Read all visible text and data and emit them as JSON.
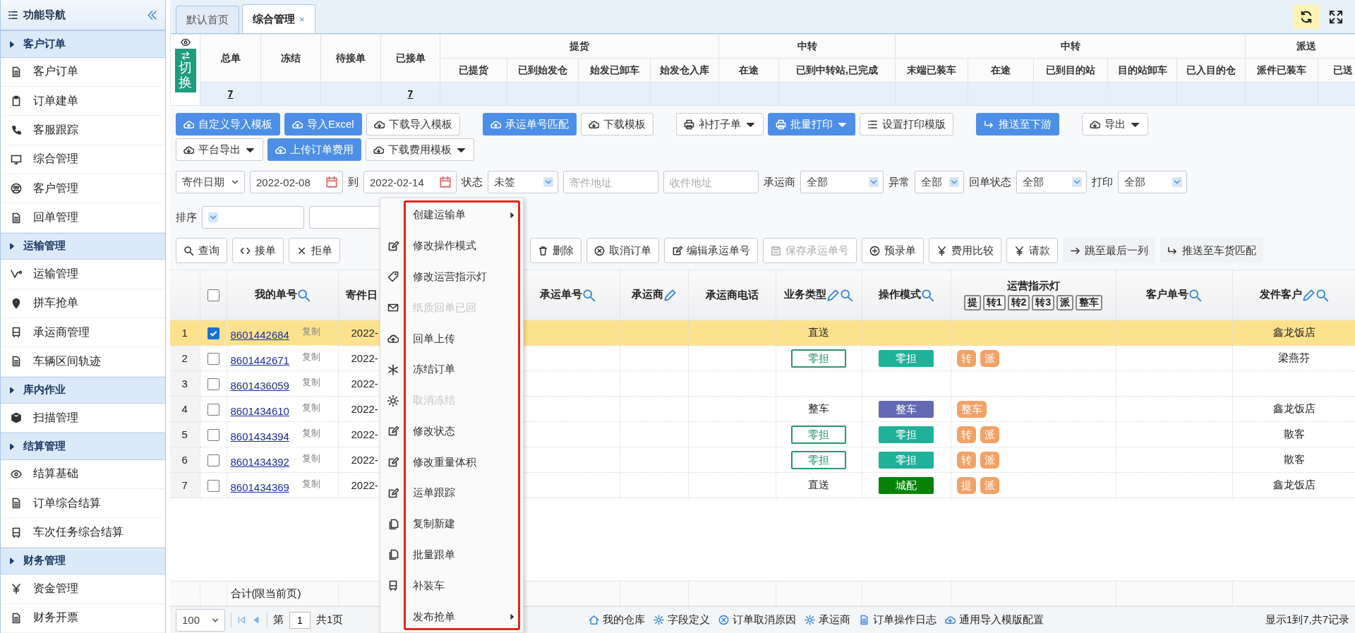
{
  "tabs": [
    {
      "label": "默认首页",
      "selected": false
    },
    {
      "label": "综合管理",
      "selected": true,
      "close": "×"
    }
  ],
  "sidebar": {
    "title": "功能导航",
    "groups": [
      {
        "label": "客户订单",
        "items": [
          "客户订单",
          "订单建单",
          "客服跟踪",
          "综合管理",
          "客户管理",
          "回单管理"
        ]
      },
      {
        "label": "运输管理",
        "items": [
          "运输管理",
          "拼车抢单",
          "承运商管理",
          "车辆区间轨迹"
        ]
      },
      {
        "label": "库内作业",
        "items": [
          "扫描管理"
        ]
      },
      {
        "label": "结算管理",
        "items": [
          "结算基础",
          "订单综合结算",
          "车次任务综合结算"
        ]
      },
      {
        "label": "财务管理",
        "items": [
          "资金管理",
          "财务开票"
        ]
      }
    ]
  },
  "summary": {
    "toggle": "切换",
    "columns": [
      {
        "label": "总单",
        "value": "7"
      },
      {
        "label": "冻结"
      },
      {
        "label": "待接单"
      },
      {
        "label": "已接单",
        "value": "7"
      }
    ],
    "groups": [
      {
        "label": "提货",
        "columns": [
          "已提货",
          "已到始发仓",
          "始发已卸车",
          "始发仓入库"
        ]
      },
      {
        "label": "中转",
        "columns": [
          "在途",
          "已到中转站,已完成"
        ]
      },
      {
        "label": "中转",
        "columns": [
          "末端已装车",
          "在途",
          "已到目的站",
          "目的站卸车",
          "已入目的仓"
        ]
      },
      {
        "label": "派送",
        "columns": [
          "派件已装车",
          "已送"
        ]
      }
    ]
  },
  "toolbar": [
    [
      {
        "label": "自定义导入模板",
        "kind": "primary",
        "dropdown": false
      },
      {
        "label": "导入Excel",
        "kind": "primary",
        "dropdown": false
      },
      {
        "label": "下载导入模板",
        "kind": "default",
        "dropdown": false
      },
      {
        "label": "承运单号匹配",
        "kind": "primary",
        "dropdown": false
      },
      {
        "label": "下载模板",
        "kind": "default",
        "dropdown": false
      },
      {
        "label": "补打子单",
        "kind": "default",
        "dropdown": true
      },
      {
        "label": "批量打印",
        "kind": "primary",
        "dropdown": true
      },
      {
        "label": "设置打印模版",
        "kind": "default",
        "dropdown": false
      },
      {
        "label": "推送至下游",
        "kind": "primary",
        "dropdown": false
      },
      {
        "label": "导出",
        "kind": "default",
        "dropdown": true
      }
    ],
    [
      {
        "label": "平台导出",
        "kind": "default",
        "dropdown": true
      },
      {
        "label": "上传订单费用",
        "kind": "primary",
        "dropdown": false
      },
      {
        "label": "下载费用模板",
        "kind": "default",
        "dropdown": true
      }
    ]
  ],
  "filters": {
    "date_field": "寄件日期",
    "date_from": "2022-02-08",
    "to": "到",
    "date_to": "2022-02-14",
    "status_label": "状态",
    "status": "未签",
    "sender_address_placeholder": "寄件地址",
    "receiver_address_placeholder": "收件地址",
    "carrier_label": "承运商",
    "carrier": "全部",
    "exception_label": "异常",
    "exception": "全部",
    "receipt_label": "回单状态",
    "receipt": "全部",
    "print_label": "打印",
    "print": "全部"
  },
  "sort": {
    "label": "排序"
  },
  "actions": [
    {
      "label": "查询",
      "disabled": false
    },
    {
      "label": "接单",
      "disabled": false
    },
    {
      "label": "拒单",
      "disabled": false
    },
    {
      "label": "删除",
      "disabled": false
    },
    {
      "label": "取消订单",
      "disabled": false
    },
    {
      "label": "编辑承运单号",
      "disabled": false
    },
    {
      "label": "保存承运单号",
      "disabled": true
    },
    {
      "label": "预录单",
      "disabled": false
    },
    {
      "label": "费用比较",
      "disabled": false
    },
    {
      "label": "请款",
      "disabled": false
    },
    {
      "label": "跳至最后一列",
      "disabled": false
    },
    {
      "label": "推送至车货匹配",
      "disabled": false
    }
  ],
  "table": {
    "header_checked": false,
    "columns": [
      {
        "kind": "rownum"
      },
      {
        "kind": "check"
      },
      {
        "kind": "text",
        "label": "我的单号",
        "search": true,
        "edit": false
      },
      {
        "kind": "text",
        "label": "寄件日",
        "search": false,
        "edit": false
      },
      {
        "kind": "blank"
      },
      {
        "kind": "text",
        "label": "承运单号",
        "search": true,
        "edit": false
      },
      {
        "kind": "text",
        "label": "承运商",
        "search": false,
        "edit": true
      },
      {
        "kind": "text",
        "label": "承运商电话",
        "search": false,
        "edit": false
      },
      {
        "kind": "text",
        "label": "业务类型",
        "search": true,
        "edit": true
      },
      {
        "kind": "text",
        "label": "操作模式",
        "search": true,
        "edit": false
      },
      {
        "kind": "lights",
        "label": "运营指示灯",
        "chips": [
          "提",
          "转1",
          "转2",
          "转3",
          "派",
          "整车"
        ]
      },
      {
        "kind": "text",
        "label": "客户单号",
        "search": true,
        "edit": false
      },
      {
        "kind": "text",
        "label": "发件客户",
        "search": true,
        "edit": true
      }
    ],
    "rows": [
      {
        "num": "1",
        "selected": true,
        "checked": true,
        "order_no": "8601442684",
        "copy": "复制",
        "date": "2022-",
        "biz_type": "直送",
        "biz_outlined": false,
        "lights": [],
        "sender": "鑫龙饭店"
      },
      {
        "num": "2",
        "selected": false,
        "checked": false,
        "order_no": "8601442671",
        "copy": "复制",
        "date": "2022-",
        "biz_type": "零担",
        "biz_outlined": true,
        "op_mode": {
          "text": "零担",
          "color": "#1fb199"
        },
        "lights": [
          "转",
          "派"
        ],
        "sender": "梁燕芬"
      },
      {
        "num": "3",
        "selected": false,
        "checked": false,
        "order_no": "8601436059",
        "copy": "复制",
        "date": "2022-",
        "lights": []
      },
      {
        "num": "4",
        "selected": false,
        "checked": false,
        "order_no": "8601434610",
        "copy": "复制",
        "date": "2022-",
        "biz_type": "整车",
        "biz_outlined": false,
        "op_mode": {
          "text": "整车",
          "color": "#6469b4"
        },
        "lights": [
          "整车"
        ],
        "sender": "鑫龙饭店"
      },
      {
        "num": "5",
        "selected": false,
        "checked": false,
        "order_no": "8601434394",
        "copy": "复制",
        "date": "2022-",
        "biz_type": "零担",
        "biz_outlined": true,
        "op_mode": {
          "text": "零担",
          "color": "#1fb199"
        },
        "lights": [
          "转",
          "派"
        ],
        "sender": "散客"
      },
      {
        "num": "6",
        "selected": false,
        "checked": false,
        "order_no": "8601434392",
        "copy": "复制",
        "date": "2022-",
        "biz_type": "零担",
        "biz_outlined": true,
        "op_mode": {
          "text": "零担",
          "color": "#1fb199"
        },
        "lights": [
          "转",
          "派"
        ],
        "sender": "散客"
      },
      {
        "num": "7",
        "selected": false,
        "checked": false,
        "order_no": "8601434369",
        "copy": "复制",
        "date": "2022-",
        "biz_type": "直送",
        "biz_outlined": false,
        "op_mode": {
          "text": "城配",
          "color": "#078207"
        },
        "lights": [
          "提",
          "派"
        ],
        "sender": "鑫龙饭店"
      }
    ],
    "footer": "合计(限当前页)"
  },
  "pager": {
    "page_size": "100",
    "page_prefix": "第",
    "page": "1",
    "page_total": "共1页",
    "links": [
      "我的仓库",
      "字段定义",
      "订单取消原因",
      "承运商",
      "订单操作日志",
      "通用导入模版配置"
    ],
    "summary": "显示1到7,共7记录"
  },
  "context_menu": [
    {
      "label": "创建运输单",
      "disabled": false,
      "submenu": true
    },
    {
      "label": "修改操作模式",
      "disabled": false,
      "submenu": false
    },
    {
      "label": "修改运营指示灯",
      "disabled": false,
      "submenu": false
    },
    {
      "label": "纸质回单已回",
      "disabled": true,
      "submenu": false
    },
    {
      "label": "回单上传",
      "disabled": false,
      "submenu": false
    },
    {
      "label": "冻结订单",
      "disabled": false,
      "submenu": false
    },
    {
      "label": "取消冻结",
      "disabled": true,
      "submenu": false
    },
    {
      "label": "修改状态",
      "disabled": false,
      "submenu": false
    },
    {
      "label": "修改重量体积",
      "disabled": false,
      "submenu": false
    },
    {
      "label": "运单跟踪",
      "disabled": false,
      "submenu": false
    },
    {
      "label": "复制新建",
      "disabled": false,
      "submenu": false
    },
    {
      "label": "批量跟单",
      "disabled": false,
      "submenu": false
    },
    {
      "label": "补装车",
      "disabled": false,
      "submenu": false
    },
    {
      "label": "发布抢单",
      "disabled": false,
      "submenu": true
    }
  ]
}
